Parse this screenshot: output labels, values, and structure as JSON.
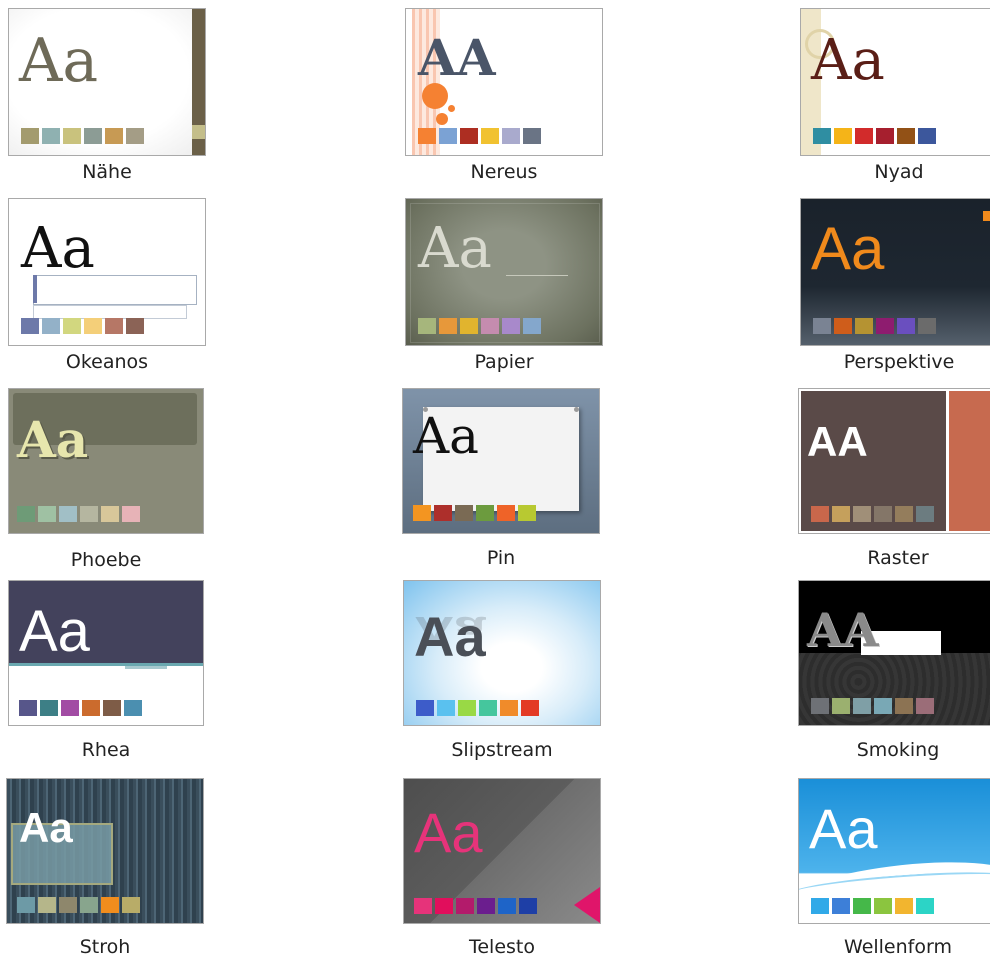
{
  "aa_text": "Aa",
  "aa_upper": "AA",
  "themes": [
    {
      "name": "Nähe",
      "swatches": [
        "#a39b6e",
        "#8fb1b1",
        "#c9c27d",
        "#8c9c95",
        "#c79a54",
        "#a49d86"
      ]
    },
    {
      "name": "Nereus",
      "swatches": [
        "#f58132",
        "#7ba2d4",
        "#ad2e22",
        "#f1c231",
        "#a9aacd",
        "#6a7485"
      ]
    },
    {
      "name": "Nyad",
      "swatches": [
        "#2f8ea2",
        "#f5b418",
        "#d22b2b",
        "#a61f2e",
        "#925116",
        "#3c579c"
      ]
    },
    {
      "name": "Okeanos",
      "swatches": [
        "#6d79a9",
        "#93b1c8",
        "#d2d77f",
        "#f4cf79",
        "#b67766",
        "#8b6356"
      ]
    },
    {
      "name": "Papier",
      "swatches": [
        "#a6b67c",
        "#e7983a",
        "#e1b42e",
        "#c58caf",
        "#a889cb",
        "#84a7cc"
      ]
    },
    {
      "name": "Perspektive",
      "swatches": [
        "#7a8393",
        "#cf5d1b",
        "#b59332",
        "#8e1c6f",
        "#6a4fbf",
        "#6b6b6b"
      ]
    },
    {
      "name": "Phoebe",
      "swatches": [
        "#6e9b77",
        "#9fc1a3",
        "#a1bfc6",
        "#b5b6a0",
        "#d8c79a",
        "#e7b3b7"
      ]
    },
    {
      "name": "Pin",
      "swatches": [
        "#f39521",
        "#ad2f2b",
        "#7a6a54",
        "#6c9b3e",
        "#ef6328",
        "#b8c931"
      ]
    },
    {
      "name": "Raster",
      "swatches": [
        "#c9674b",
        "#c5a05c",
        "#a08f78",
        "#847668",
        "#947d5c",
        "#6c7c80"
      ]
    },
    {
      "name": "Rhea",
      "swatches": [
        "#57568a",
        "#3d7f86",
        "#a24ca4",
        "#cb6b2d",
        "#7e5c47",
        "#4b8fb0"
      ]
    },
    {
      "name": "Slipstream",
      "swatches": [
        "#3d5cc9",
        "#5ac1ef",
        "#99d945",
        "#45c69d",
        "#f08b2a",
        "#e33a25"
      ]
    },
    {
      "name": "Smoking",
      "swatches": [
        "#6e7176",
        "#9bb06f",
        "#7f9fa6",
        "#79a8b5",
        "#8c7353",
        "#9b6d78"
      ]
    },
    {
      "name": "Stroh",
      "swatches": [
        "#6d9aa6",
        "#b5b68a",
        "#8e876c",
        "#88a58d",
        "#f08d1d",
        "#b8ac68"
      ]
    },
    {
      "name": "Telesto",
      "swatches": [
        "#e6337a",
        "#e10e5c",
        "#b31b6b",
        "#6b1e8e",
        "#1e64c8",
        "#1e3fa6"
      ]
    },
    {
      "name": "Wellenform",
      "swatches": [
        "#31a9e8",
        "#3d7fd8",
        "#45b849",
        "#8bc53f",
        "#f2b52f",
        "#2cd4c6"
      ]
    }
  ]
}
